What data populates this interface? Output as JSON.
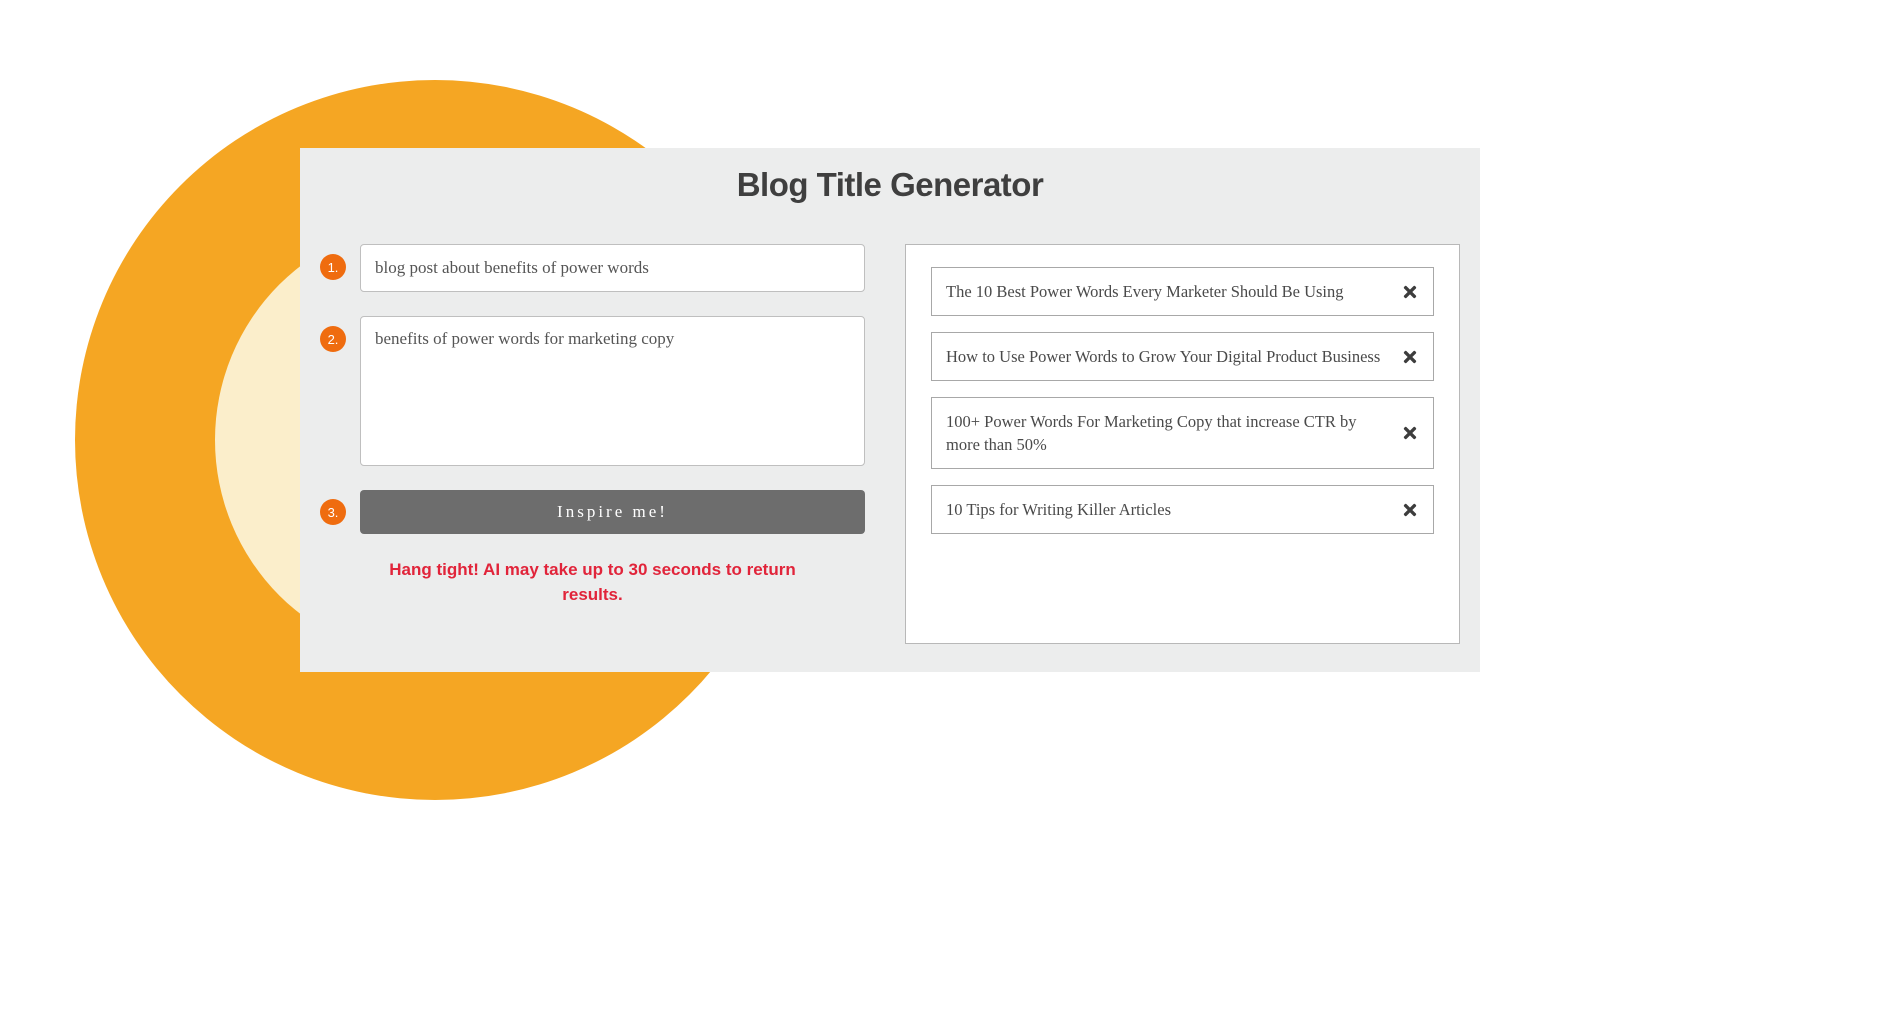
{
  "title": "Blog Title Generator",
  "steps": {
    "s1": {
      "num": "1.",
      "value": "blog post about benefits of power words"
    },
    "s2": {
      "num": "2.",
      "value": "benefits of power words for marketing copy"
    },
    "s3": {
      "num": "3.",
      "button": "Inspire me!"
    }
  },
  "status": "Hang tight! AI may take up to 30 seconds to return results.",
  "results": [
    "The 10 Best Power Words Every Marketer Should Be Using",
    "How to Use Power Words to Grow Your Digital Product Business",
    "100+ Power Words For Marketing Copy that increase CTR by more than 50%",
    "10 Tips for Writing Killer Articles"
  ]
}
